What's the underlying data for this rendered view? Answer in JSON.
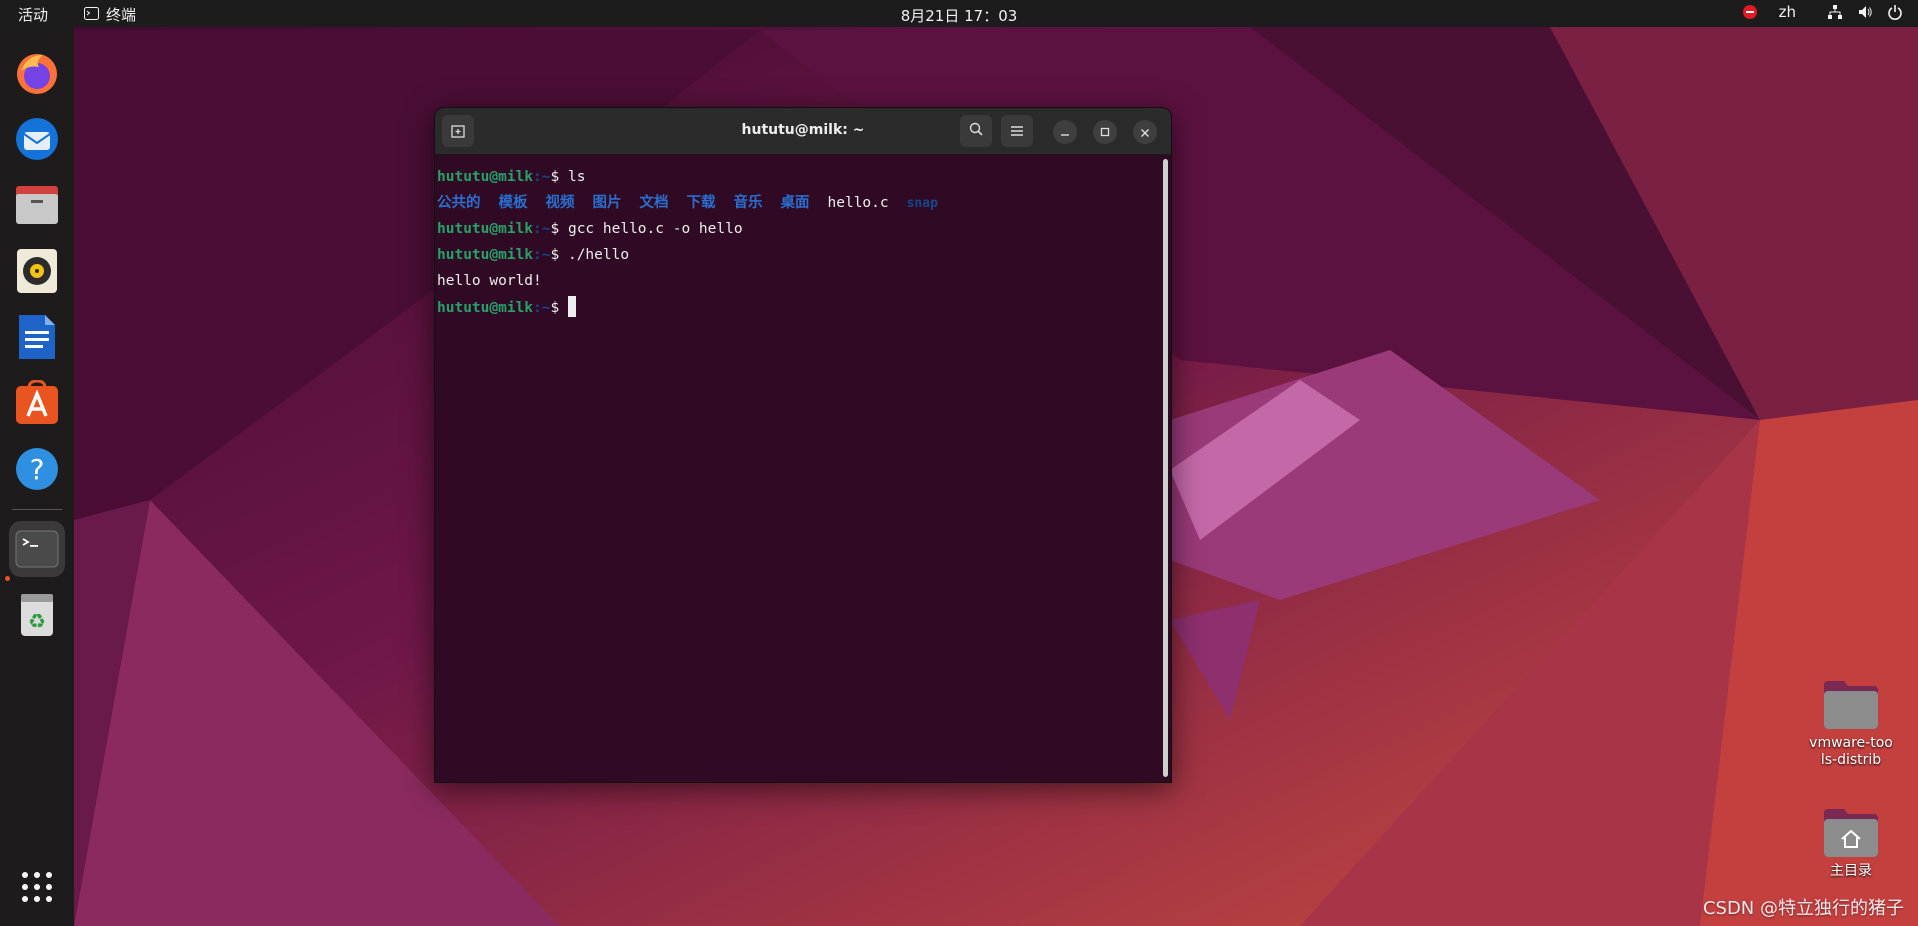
{
  "topbar": {
    "activities": "活动",
    "app_name": "终端",
    "clock": "8月21日 17：03",
    "input_method": "zh"
  },
  "dock": {
    "items": [
      "firefox",
      "thunderbird",
      "files",
      "rhythmbox",
      "libreoffice-writer",
      "app-center",
      "help",
      "terminal",
      "trash",
      "show-apps"
    ],
    "active": "terminal",
    "accent": "#e95420"
  },
  "terminal": {
    "title": "hututu@milk: ~",
    "prompt_user": "hututu@milk",
    "prompt_path": ":~",
    "prompt_symbol": "$ ",
    "commands": [
      "ls",
      "gcc hello.c -o hello",
      "./hello"
    ],
    "ls_dirs": [
      "公共的",
      "模板",
      "视频",
      "图片",
      "文档",
      "下载",
      "音乐",
      "桌面"
    ],
    "ls_file": "hello.c",
    "ls_snap": "snap",
    "output": "hello world!",
    "colors": {
      "background": "#300a24",
      "user": "#26a269",
      "path": "#12488b",
      "dir": "#2a6fd0"
    }
  },
  "desktop": {
    "icons": [
      {
        "label": "vmware-tools-distrib",
        "icon": "folder-icon"
      },
      {
        "label": "主目录",
        "icon": "home-folder-icon"
      }
    ]
  },
  "watermark": "CSDN @特立独行的猪子"
}
